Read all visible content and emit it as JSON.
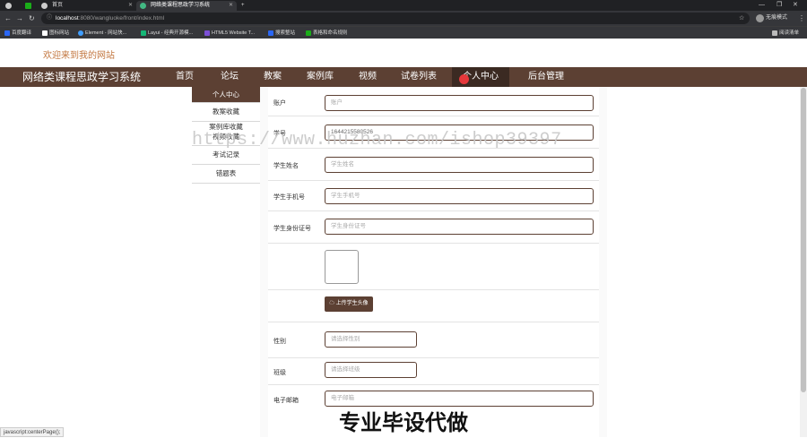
{
  "browser": {
    "tabs": [
      {
        "title": ""
      },
      {
        "title": "首页"
      },
      {
        "title": "网络类课程思政学习系统"
      }
    ],
    "new_tab_label": "+",
    "url_host": "localhost",
    "url_path": ":8080/wangluoke/front/index.html",
    "profile_label": "无痕模式",
    "bookmarks": [
      {
        "label": "百度翻译",
        "color": "#2b67f6"
      },
      {
        "label": "图标网站",
        "color": "#ffffff"
      },
      {
        "label": "Element - 网站快...",
        "color": "#409eff"
      },
      {
        "label": "Layui - 经典开源模...",
        "color": "#16b777"
      },
      {
        "label": "HTML5 Website T...",
        "color": "#7b4fd6"
      },
      {
        "label": "搜索整站",
        "color": "#2b67f6"
      },
      {
        "label": "表格和命名规则",
        "color": "#1aad19"
      }
    ],
    "reading_list": "阅读清单"
  },
  "site": {
    "welcome": "欢迎来到我的网站",
    "brand": "网络类课程思政学习系统",
    "nav": [
      "首页",
      "论坛",
      "教案",
      "案例库",
      "视频",
      "试卷列表",
      "个人中心",
      "后台管理"
    ]
  },
  "sidebar": {
    "items": [
      "个人中心",
      "教案收藏",
      "案例库收藏",
      "视频收藏",
      "考试记录",
      "错题表"
    ]
  },
  "form": {
    "account": {
      "label": "账户",
      "placeholder": "账户"
    },
    "student_no": {
      "label": "学号",
      "value": "1644215580526"
    },
    "student_name": {
      "label": "学生姓名",
      "placeholder": "学生姓名"
    },
    "student_phone": {
      "label": "学生手机号",
      "placeholder": "学生手机号"
    },
    "student_id": {
      "label": "学生身份证号",
      "placeholder": "学生身份证号"
    },
    "upload_label": "上传学生头像",
    "gender": {
      "label": "性别",
      "placeholder": "请选择性别"
    },
    "class": {
      "label": "班级",
      "placeholder": "请选择班级"
    },
    "email": {
      "label": "电子邮箱",
      "placeholder": "电子邮箱"
    }
  },
  "overlay": {
    "watermark": "https://www.huzhan.com/ishop39397",
    "caption": "专业毕设代做"
  },
  "status_url": "javascript:centerPage();",
  "colors": {
    "brand_brown": "#5c4033",
    "welcome_orange": "#c2763f"
  }
}
